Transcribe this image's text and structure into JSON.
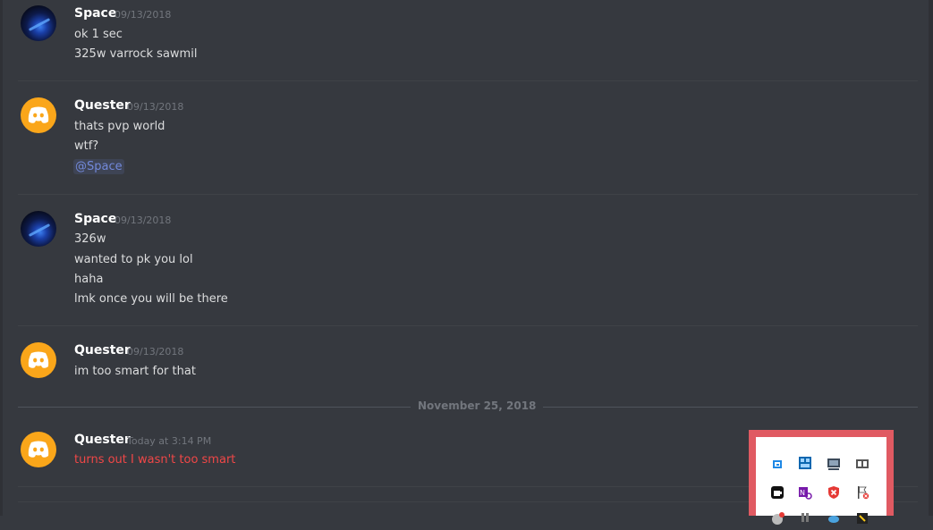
{
  "messages": [
    {
      "user": "Space",
      "timestamp": "09/13/2018",
      "lines": [
        "ok 1 sec",
        "325w varrock sawmil"
      ]
    },
    {
      "user": "Quester",
      "timestamp": "09/13/2018",
      "lines": [
        "thats pvp world",
        "wtf?"
      ],
      "mention": "@Space"
    },
    {
      "user": "Space",
      "timestamp": "09/13/2018",
      "lines": [
        "326w",
        "wanted to pk you lol",
        "haha",
        "lmk once you will be there"
      ]
    },
    {
      "user": "Quester",
      "timestamp": "09/13/2018",
      "lines": [
        "im too smart for that"
      ]
    },
    {
      "user": "Quester",
      "timestamp": "Today at 3:14 PM",
      "lines": [
        "turns out I wasn't too smart"
      ]
    }
  ],
  "date_divider": "November 25, 2018",
  "tray_icons": [
    "update-icon",
    "network-icon",
    "display-icon",
    "dolby-icon",
    "coffee-icon",
    "onenote-icon",
    "shield-icon",
    "flag-icon",
    "discord-icon",
    "usb-icon",
    "cloud-icon",
    "tool-icon"
  ],
  "colors": {
    "background": "#36393f",
    "username": "#ffffff",
    "message_text": "#dcddde",
    "timestamp": "#72767d",
    "mention": "#7289da",
    "error_text": "#f04747",
    "avatar_quester": "#faa61a",
    "tray_highlight": "#e05a62"
  }
}
